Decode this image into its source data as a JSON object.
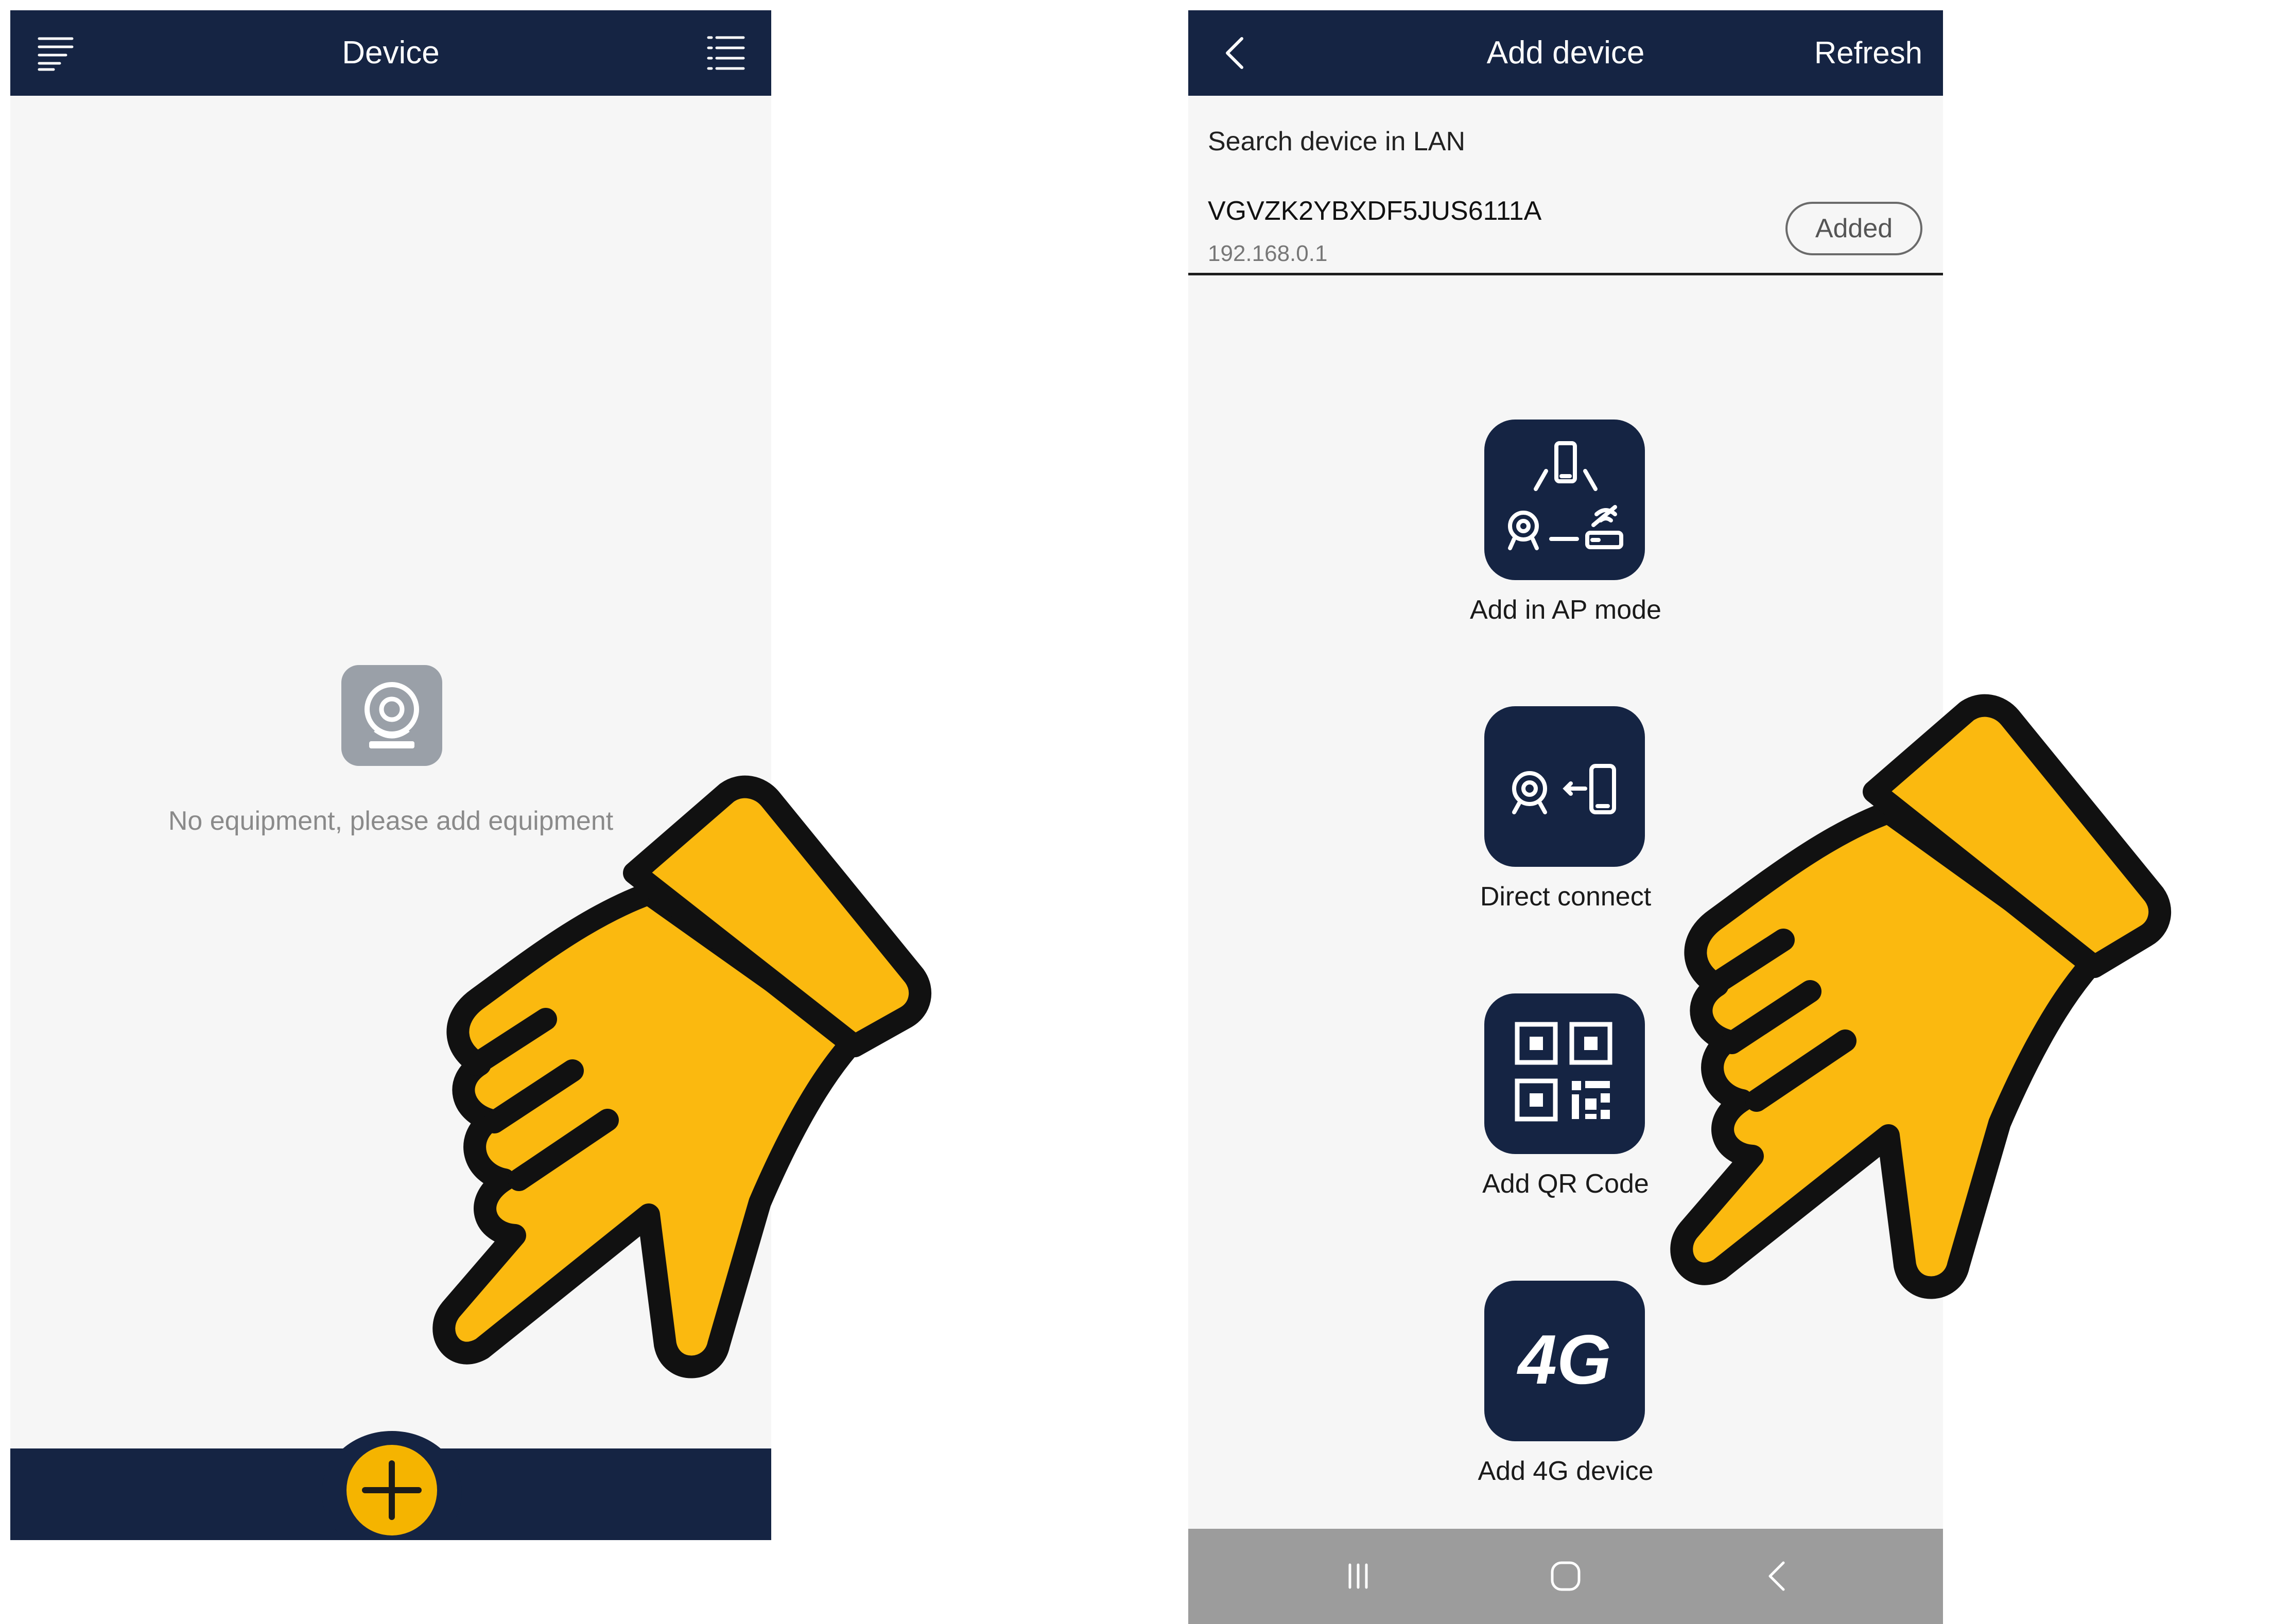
{
  "left_screen": {
    "title": "Device",
    "menu_icon": "hamburger-menu-icon",
    "list_icon": "list-view-icon",
    "empty_icon": "camera-icon",
    "empty_message": "No equipment, please add equipment",
    "add_icon": "plus-icon"
  },
  "right_screen": {
    "title": "Add device",
    "back_icon": "back-chevron-icon",
    "refresh_label": "Refresh",
    "search_section_title": "Search device in LAN",
    "found_device": {
      "id": "VGVZK2YBXDF5JUS6111A",
      "ip": "192.168.0.1",
      "status_label": "Added"
    },
    "options": [
      {
        "label": "Add in AP mode",
        "icon": "ap-mode-icon"
      },
      {
        "label": "Direct connect",
        "icon": "direct-connect-icon"
      },
      {
        "label": "Add QR Code",
        "icon": "qr-code-icon"
      },
      {
        "label": "Add 4G device",
        "icon": "4g-icon",
        "icon_text": "4G"
      }
    ],
    "system_nav": [
      "recent-apps-icon",
      "home-icon",
      "back-icon"
    ]
  },
  "colors": {
    "header": "#152443",
    "background": "#f6f6f6",
    "accent": "#f5b400",
    "hand_fill": "#fbb90f",
    "navbar": "#9c9c9c"
  },
  "overlay_icons": [
    "pointing-hand-icon",
    "pointing-hand-icon"
  ]
}
